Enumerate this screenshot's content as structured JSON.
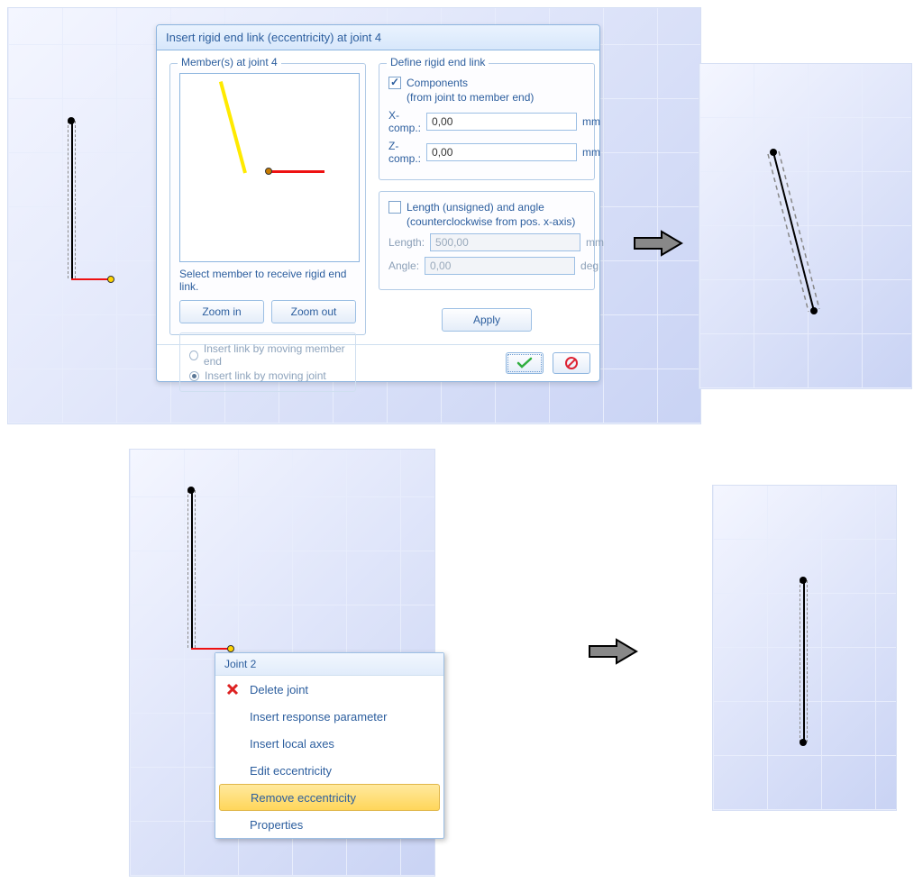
{
  "dialog": {
    "title": "Insert rigid end link (eccentricity) at joint 4",
    "members_group_title": "Member(s) at joint 4",
    "select_hint": "Select member to receive rigid end link.",
    "zoom_in": "Zoom in",
    "zoom_out": "Zoom out",
    "radio_member_end": "Insert link by moving member end",
    "radio_joint": "Insert link by moving joint",
    "define_group_title": "Define rigid end link",
    "components_label": "Components",
    "components_sub": "(from joint to member end)",
    "x_label": "X-comp.:",
    "z_label": "Z-comp.:",
    "x_value": "0,00",
    "z_value": "0,00",
    "unit_mm": "mm",
    "length_angle_label": "Length (unsigned) and angle",
    "length_angle_sub": "(counterclockwise from pos. x-axis)",
    "length_label": "Length:",
    "angle_label": "Angle:",
    "length_value": "500,00",
    "angle_value": "0,00",
    "unit_deg": "deg",
    "apply": "Apply"
  },
  "context_menu": {
    "header": "Joint 2",
    "items": {
      "delete": "Delete joint",
      "insert_response": "Insert response parameter",
      "insert_axes": "Insert local axes",
      "edit_ecc": "Edit eccentricity",
      "remove_ecc": "Remove eccentricity",
      "properties": "Properties"
    }
  }
}
